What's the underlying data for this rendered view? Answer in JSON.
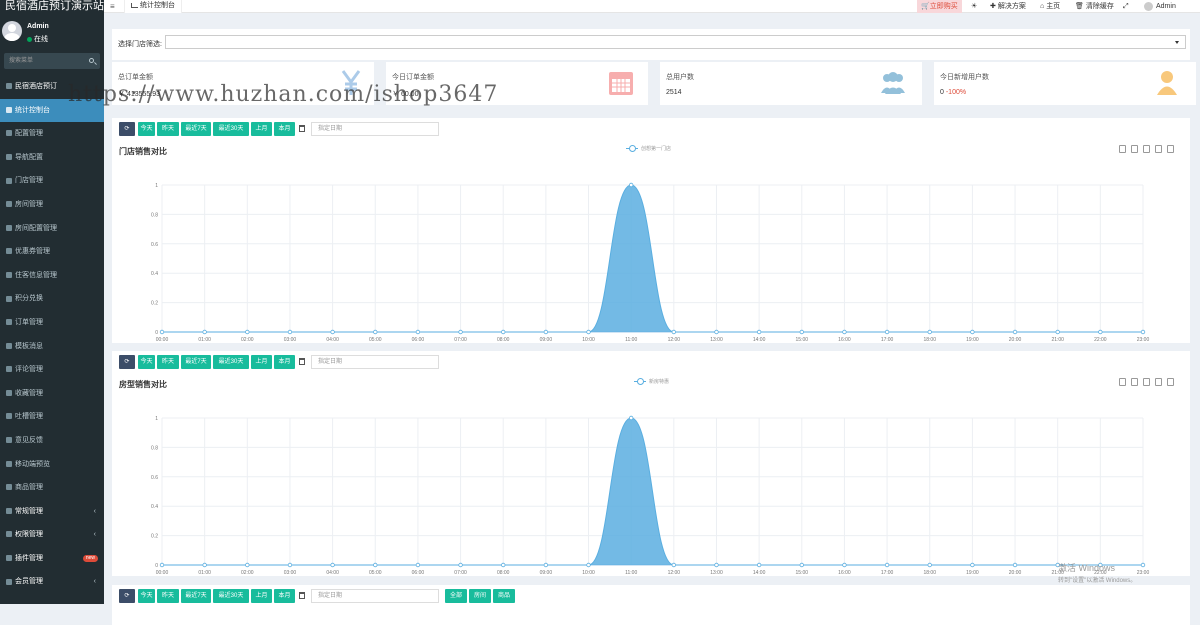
{
  "app": {
    "title": "民宿酒店预订演示站"
  },
  "user": {
    "name": "Admin",
    "status": "在线"
  },
  "sidebar": {
    "search_placeholder": "搜索菜单",
    "items": [
      {
        "label": "民宿酒店预订",
        "icon": "home-icon",
        "type": "head"
      },
      {
        "label": "统计控制台",
        "icon": "chart-icon",
        "type": "active"
      },
      {
        "label": "配置管理",
        "icon": "gear-icon",
        "type": "item"
      },
      {
        "label": "导航配置",
        "icon": "list-icon",
        "type": "item"
      },
      {
        "label": "门店管理",
        "icon": "store-icon",
        "type": "item"
      },
      {
        "label": "房间管理",
        "icon": "home-icon",
        "type": "item"
      },
      {
        "label": "房间配置管理",
        "icon": "gear-icon",
        "type": "item"
      },
      {
        "label": "优惠券管理",
        "icon": "yen-icon",
        "type": "item"
      },
      {
        "label": "住客信息管理",
        "icon": "user-icon",
        "type": "item"
      },
      {
        "label": "积分兑换",
        "icon": "coin-icon",
        "type": "item"
      },
      {
        "label": "订单管理",
        "icon": "order-icon",
        "type": "item"
      },
      {
        "label": "模板消息",
        "icon": "message-icon",
        "type": "item"
      },
      {
        "label": "评论管理",
        "icon": "comment-icon",
        "type": "item"
      },
      {
        "label": "收藏管理",
        "icon": "heart-icon",
        "type": "item"
      },
      {
        "label": "吐槽管理",
        "icon": "chat-icon",
        "type": "item"
      },
      {
        "label": "意见反馈",
        "icon": "pencil-icon",
        "type": "item"
      },
      {
        "label": "移动端预览",
        "icon": "mobile-icon",
        "type": "item"
      },
      {
        "label": "商品管理",
        "icon": "goods-icon",
        "type": "item"
      },
      {
        "label": "常规管理",
        "icon": "cogs-icon",
        "type": "sub",
        "arrow": "‹"
      },
      {
        "label": "权限管理",
        "icon": "group-icon",
        "type": "sub",
        "arrow": "‹"
      },
      {
        "label": "插件管理",
        "icon": "rocket-icon",
        "type": "sub",
        "badge": "new"
      },
      {
        "label": "会员管理",
        "icon": "member-icon",
        "type": "sub",
        "arrow": "‹"
      }
    ]
  },
  "topbar": {
    "menu_icon": "≡",
    "tab_label": "统计控制台",
    "buy_label": "立即购买",
    "solutions_label": "解决方案",
    "home_label": "主页",
    "clear_cache_label": "清除缓存",
    "user_label": "Admin"
  },
  "filter": {
    "label": "选择门店筛选:",
    "value": ""
  },
  "stats": [
    {
      "title": "总订单金额",
      "value": "￥ 413555.93",
      "icon": "yen-icon",
      "color": "#6aa1d8"
    },
    {
      "title": "今日订单金额",
      "value": "￥ 60.00",
      "icon": "calendar-icon",
      "color": "#f26c6c"
    },
    {
      "title": "总用户数",
      "value": "2514",
      "icon": "users-icon",
      "color": "#3c8dbc"
    },
    {
      "title": "今日新增用户数",
      "value": "0",
      "extra": " -100%",
      "icon": "user-icon",
      "color": "#f39c12"
    }
  ],
  "date_buttons": [
    "今天",
    "昨天",
    "最近7天",
    "最近30天",
    "上月",
    "本月"
  ],
  "date_placeholder": "指定日期",
  "extra_buttons": [
    "全部",
    "房间",
    "商品"
  ],
  "charts": [
    {
      "title": "门店销售对比",
      "chart_data": {
        "type": "area",
        "title": "门店销售对比",
        "series": [
          {
            "name": "创想第一门店",
            "values": [
              0,
              0,
              0,
              0,
              0,
              0,
              0,
              0,
              0,
              0,
              0,
              1,
              0,
              0,
              0,
              0,
              0,
              0,
              0,
              0,
              0,
              0,
              0,
              0
            ]
          }
        ],
        "x": [
          "00:00",
          "01:00",
          "02:00",
          "03:00",
          "04:00",
          "05:00",
          "06:00",
          "07:00",
          "08:00",
          "09:00",
          "10:00",
          "11:00",
          "12:00",
          "13:00",
          "14:00",
          "15:00",
          "16:00",
          "17:00",
          "18:00",
          "19:00",
          "20:00",
          "21:00",
          "22:00",
          "23:00"
        ],
        "yticks": [
          "0",
          "0.2",
          "0.4",
          "0.6",
          "0.8",
          "1"
        ],
        "ylim": [
          0,
          1
        ],
        "color": "#5aaee0",
        "grid": true,
        "legend": "top-center"
      }
    },
    {
      "title": "房型销售对比",
      "chart_data": {
        "type": "area",
        "title": "房型销售对比",
        "series": [
          {
            "name": "新房特惠",
            "values": [
              0,
              0,
              0,
              0,
              0,
              0,
              0,
              0,
              0,
              0,
              0,
              1,
              0,
              0,
              0,
              0,
              0,
              0,
              0,
              0,
              0,
              0,
              0,
              0
            ]
          }
        ],
        "x": [
          "00:00",
          "01:00",
          "02:00",
          "03:00",
          "04:00",
          "05:00",
          "06:00",
          "07:00",
          "08:00",
          "09:00",
          "10:00",
          "11:00",
          "12:00",
          "13:00",
          "14:00",
          "15:00",
          "16:00",
          "17:00",
          "18:00",
          "19:00",
          "20:00",
          "21:00",
          "22:00",
          "23:00"
        ],
        "yticks": [
          "0",
          "0.2",
          "0.4",
          "0.6",
          "0.8",
          "1"
        ],
        "ylim": [
          0,
          1
        ],
        "color": "#5aaee0",
        "grid": true,
        "legend": "top-center"
      }
    }
  ],
  "watermark": "https://www.huzhan.com/ishop3647",
  "windows_activation": {
    "title": "激活 Windows",
    "subtitle": "转到\"设置\"以激活 Windows。"
  }
}
